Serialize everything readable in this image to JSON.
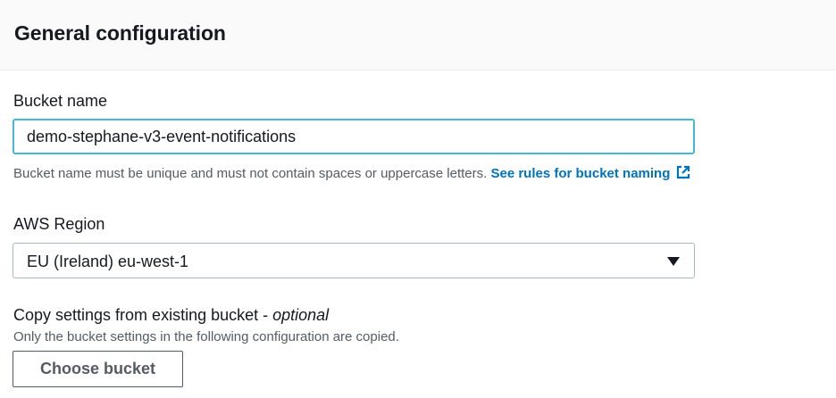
{
  "panel": {
    "title": "General configuration"
  },
  "bucket_name": {
    "label": "Bucket name",
    "value": "demo-stephane-v3-event-notifications",
    "hint": "Bucket name must be unique and must not contain spaces or uppercase letters.",
    "rules_link": "See rules for bucket naming",
    "rules_icon": "external-link-icon"
  },
  "region": {
    "label": "AWS Region",
    "selected": "EU (Ireland) eu-west-1",
    "caret_icon": "caret-down-icon"
  },
  "copy_settings": {
    "label": "Copy settings from existing bucket - ",
    "optional": "optional",
    "description": "Only the bucket settings in the following configuration are copied.",
    "button_label": "Choose bucket"
  },
  "colors": {
    "accent_link": "#0073bb",
    "input_focus_border": "#44b9d6",
    "header_background": "#fafafa"
  }
}
